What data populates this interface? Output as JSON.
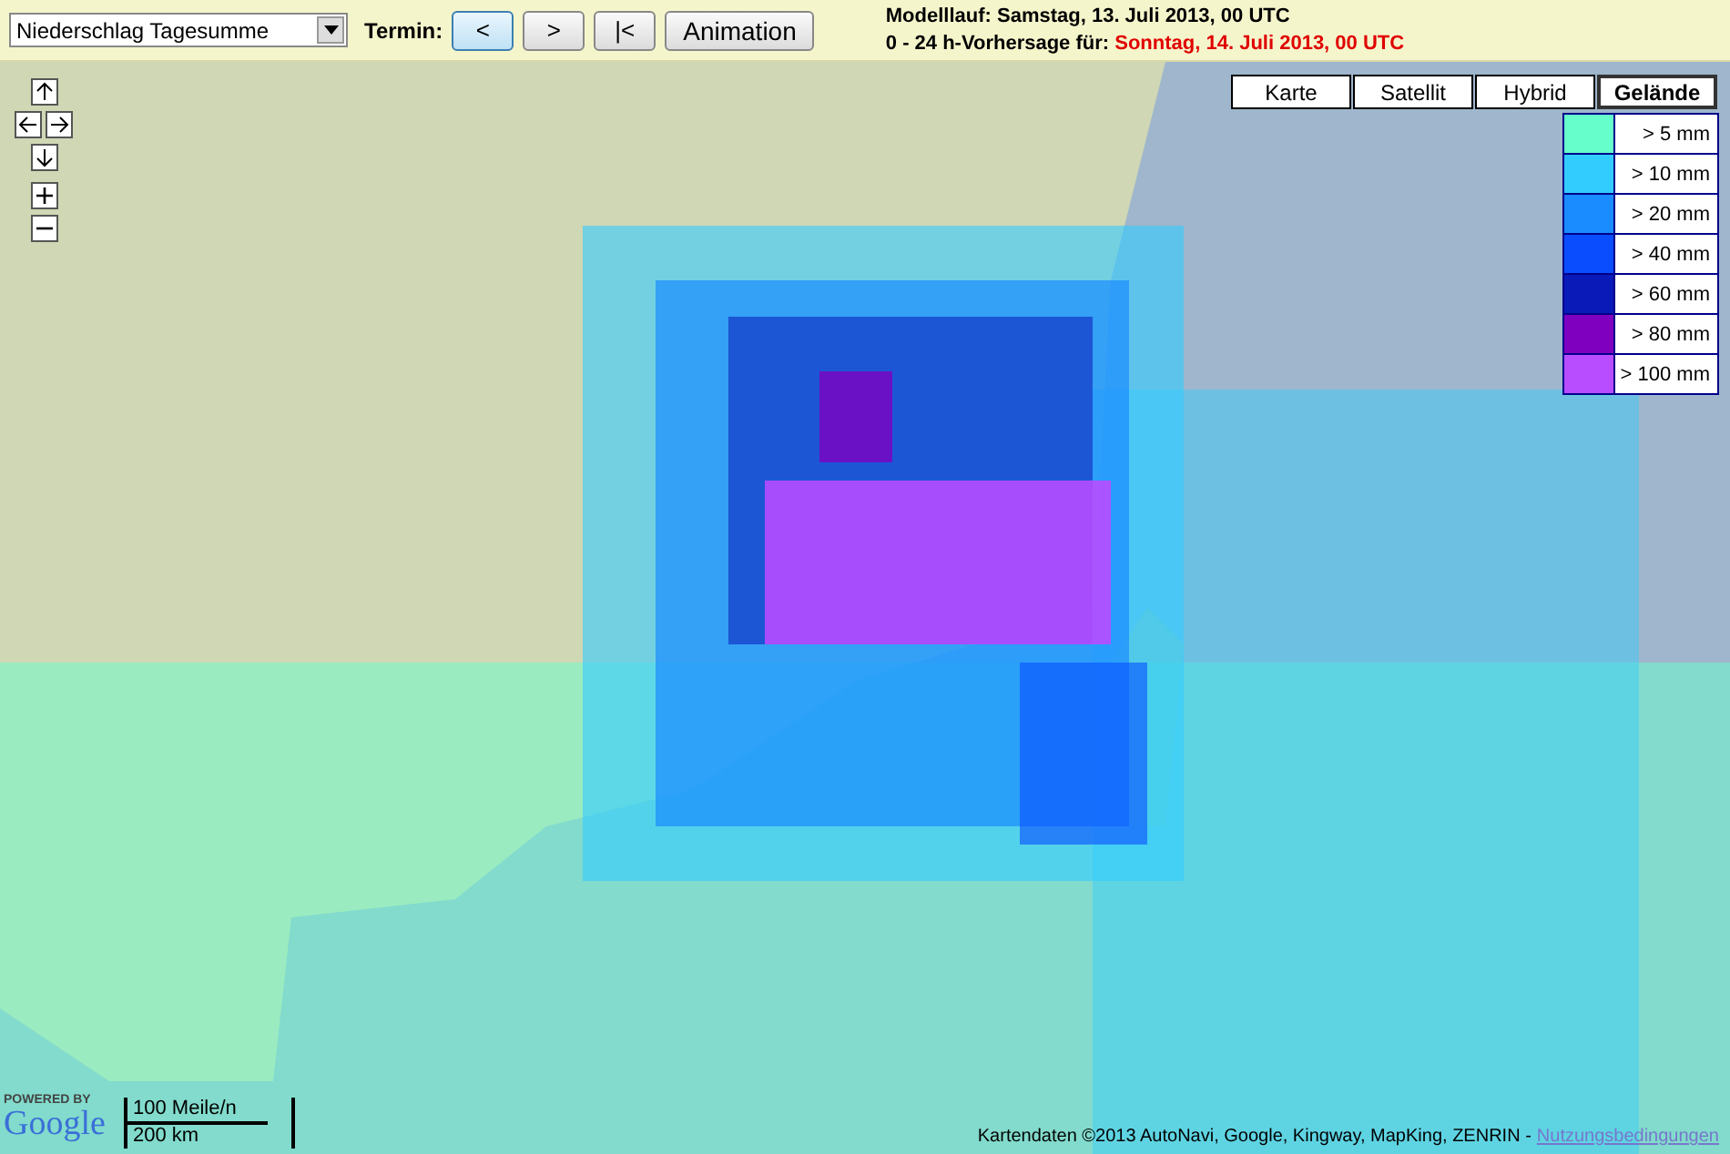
{
  "toolbar": {
    "product_select": {
      "value": "Niederschlag Tagesumme"
    },
    "termin_label": "Termin:",
    "nav_buttons": [
      {
        "label": "<",
        "kind": "prev"
      },
      {
        "label": ">",
        "kind": "next"
      },
      {
        "label": "|<",
        "kind": "first"
      },
      {
        "label": "Animation",
        "kind": "animation"
      }
    ],
    "run_info": {
      "label": "Modelllauf:",
      "value": "Samstag, 13. Juli 2013, 00 UTC"
    },
    "forecast_info": {
      "label": "0 - 24 h-Vorhersage für:",
      "value": "Sonntag, 14. Juli 2013, 00 UTC"
    }
  },
  "map": {
    "map_types": [
      {
        "label": "Karte",
        "selected": false
      },
      {
        "label": "Satellit",
        "selected": false
      },
      {
        "label": "Hybrid",
        "selected": false
      },
      {
        "label": "Gelände",
        "selected": true
      }
    ],
    "legend": [
      {
        "label": "> 5 mm",
        "color": "#66ffcc"
      },
      {
        "label": "> 10 mm",
        "color": "#33ccff"
      },
      {
        "label": "> 20 mm",
        "color": "#1a8cff"
      },
      {
        "label": "> 40 mm",
        "color": "#0a4dff"
      },
      {
        "label": "> 60 mm",
        "color": "#0a1ab8"
      },
      {
        "label": "> 80 mm",
        "color": "#8000c0"
      },
      {
        "label": "> 100 mm",
        "color": "#b84dff"
      }
    ],
    "powered_by": "POWERED BY",
    "logo": "Google",
    "scale": {
      "imperial": "100 Meile/n",
      "metric": "200 km"
    },
    "attribution": "Kartendaten ©2013 AutoNavi, Google, Kingway, MapKing, ZENRIN -",
    "terms_link": "Nutzungsbedingungen"
  }
}
